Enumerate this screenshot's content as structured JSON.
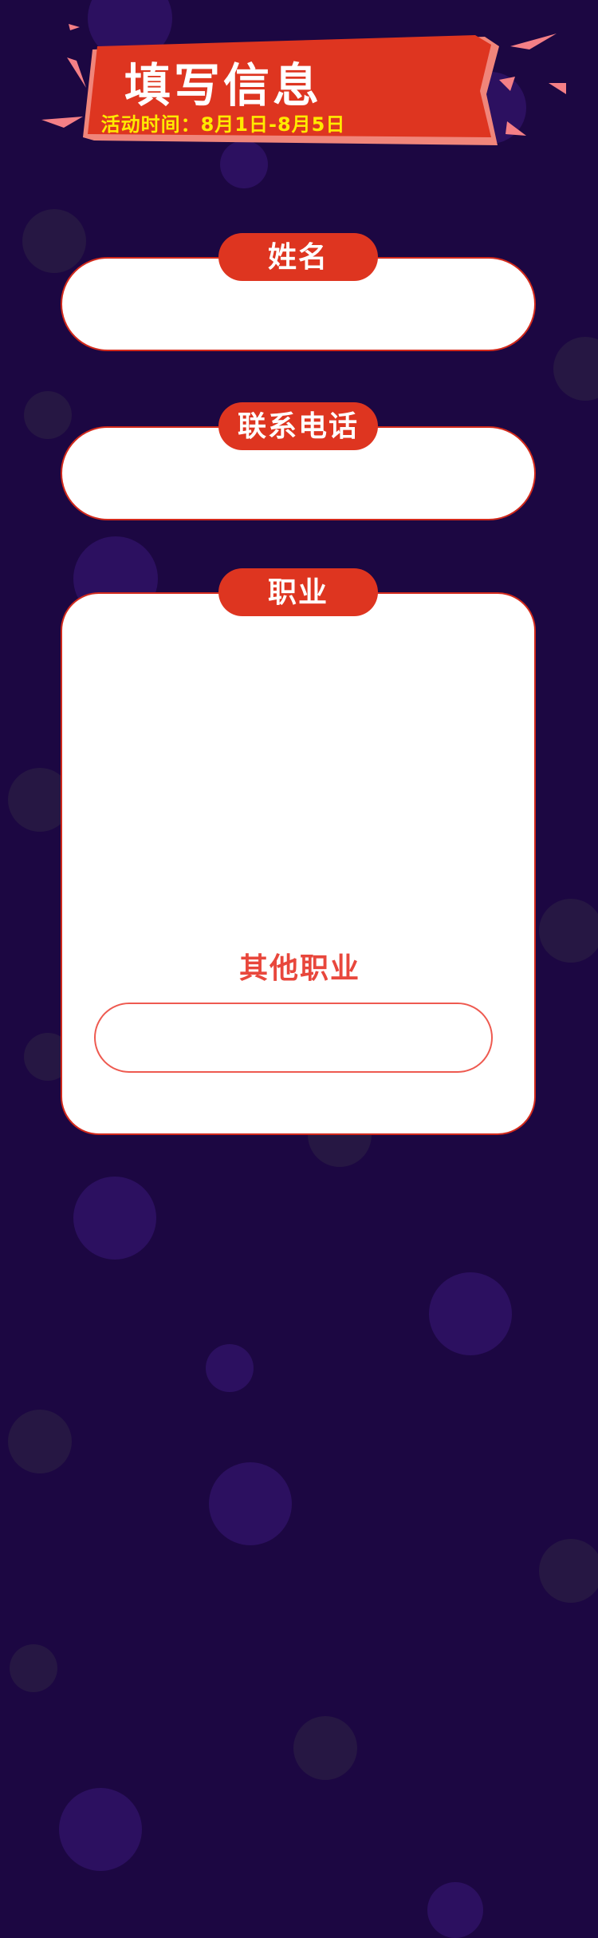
{
  "header": {
    "title": "填写信息",
    "subtitle": "活动时间：8月1日-8月5日"
  },
  "fields": {
    "name": {
      "label": "姓名",
      "value": ""
    },
    "phone": {
      "label": "联系电话",
      "value": ""
    },
    "occupation": {
      "label": "职业",
      "other_label": "其他职业",
      "other_value": ""
    }
  },
  "colors": {
    "background": "#1c0742",
    "bubble": "#2c1060",
    "banner_red": "#de3520",
    "banner_edge": "#f0857a",
    "subtitle_yellow": "#ffea00",
    "card_border": "#d22a1c",
    "other_label": "#e8473c"
  }
}
